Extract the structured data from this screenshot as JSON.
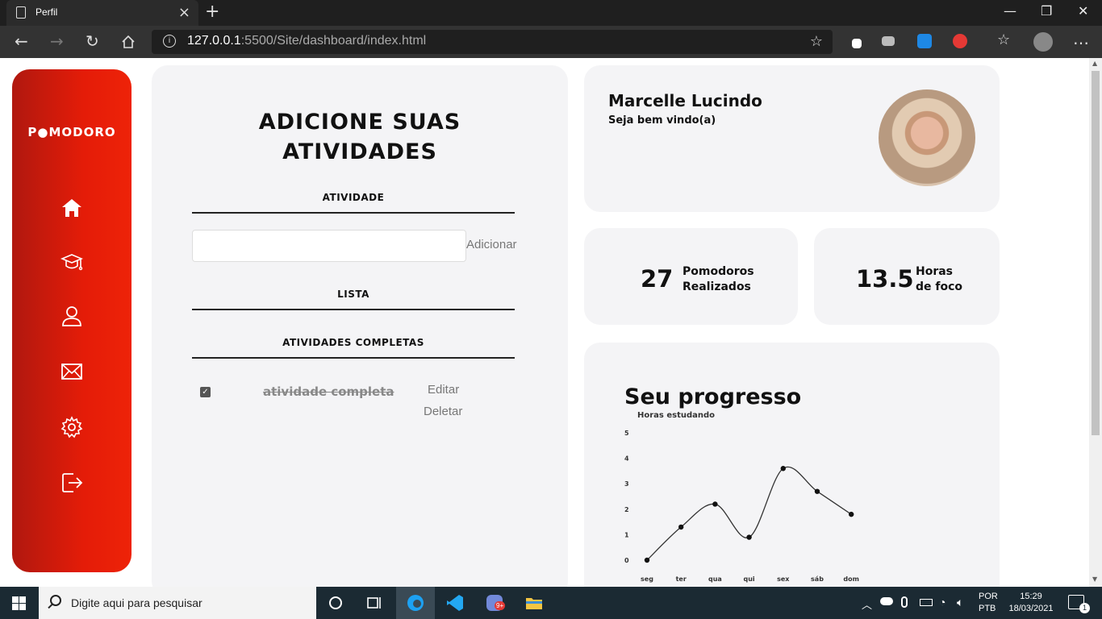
{
  "browser": {
    "tab_title": "Perfil",
    "url_host": "127.0.0.1",
    "url_path": ":5500/Site/dashboard/index.html"
  },
  "sidebar": {
    "logo": "P●MODORO",
    "items": [
      "home-icon",
      "graduation-cap-icon",
      "user-icon",
      "mail-icon",
      "settings-icon",
      "logout-icon"
    ]
  },
  "activities": {
    "title_line1": "ADICIONE SUAS",
    "title_line2": "ATIVIDADES",
    "activity_label": "ATIVIDADE",
    "add_button": "Adicionar",
    "list_label": "LISTA",
    "completed_label": "ATIVIDADES COMPLETAS",
    "completed_items": [
      {
        "text": "atividade completa",
        "checked": true,
        "edit": "Editar",
        "delete": "Deletar"
      }
    ]
  },
  "profile": {
    "name": "Marcelle Lucindo",
    "greeting": "Seja bem vindo(a)"
  },
  "stats": [
    {
      "value": "27",
      "label_line1": "Pomodoros",
      "label_line2": "Realizados"
    },
    {
      "value": "13.5",
      "label_line1": "Horas",
      "label_line2": "de foco"
    }
  ],
  "progress": {
    "title": "Seu progresso"
  },
  "chart_data": {
    "type": "line",
    "title": "Seu progresso",
    "series": [
      {
        "name": "Horas estudando",
        "values": [
          0,
          1.3,
          2.2,
          0.9,
          3.6,
          2.7,
          1.8
        ]
      }
    ],
    "categories": [
      "seg",
      "ter",
      "qua",
      "qui",
      "sex",
      "sáb",
      "dom"
    ],
    "ylim": [
      0,
      5
    ],
    "yticks": [
      "0",
      "1",
      "2",
      "3",
      "4",
      "5"
    ],
    "grid": false,
    "legend": "top-left"
  },
  "taskbar": {
    "search_placeholder": "Digite aqui para pesquisar",
    "lang_line1": "POR",
    "lang_line2": "PTB",
    "time": "15:29",
    "date": "18/03/2021",
    "notification_count": "1",
    "badge": "9+"
  }
}
